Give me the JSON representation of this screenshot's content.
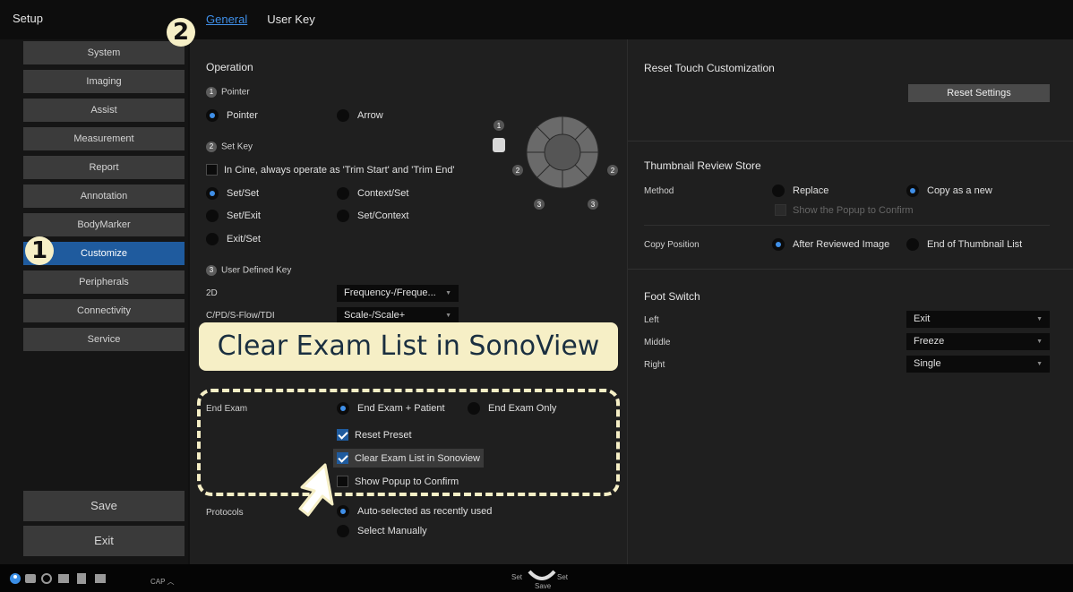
{
  "app": {
    "title": "Setup"
  },
  "tabs": [
    {
      "label": "General",
      "active": true
    },
    {
      "label": "User Key",
      "active": false
    }
  ],
  "sidebar": {
    "items": [
      "System",
      "Imaging",
      "Assist",
      "Measurement",
      "Report",
      "Annotation",
      "BodyMarker",
      "Customize",
      "Peripherals",
      "Connectivity",
      "Service"
    ],
    "active": "Customize",
    "save_label": "Save",
    "exit_label": "Exit"
  },
  "operation": {
    "title": "Operation",
    "pointer": {
      "num": "1",
      "label": "Pointer",
      "options": [
        {
          "label": "Pointer",
          "selected": true
        },
        {
          "label": "Arrow",
          "selected": false
        }
      ]
    },
    "setkey": {
      "num": "2",
      "label": "Set Key",
      "cine_check": {
        "label": "In Cine, always operate as 'Trim Start' and 'Trim End'",
        "checked": false
      },
      "options": [
        {
          "label": "Set/Set",
          "selected": true
        },
        {
          "label": "Context/Set",
          "selected": false
        },
        {
          "label": "Set/Exit",
          "selected": false
        },
        {
          "label": "Set/Context",
          "selected": false
        },
        {
          "label": "Exit/Set",
          "selected": false
        }
      ]
    },
    "userkey": {
      "num": "3",
      "label": "User Defined Key",
      "rows": [
        {
          "label": "2D",
          "value": "Frequency-/Freque..."
        },
        {
          "label": "C/PD/S-Flow/TDI",
          "value": "Scale-/Scale+"
        }
      ]
    },
    "diagram_labels": {
      "one": "1",
      "two": "2",
      "three": "3"
    }
  },
  "end_exam": {
    "label": "End Exam",
    "options": [
      {
        "label": "End Exam + Patient",
        "selected": true
      },
      {
        "label": "End Exam Only",
        "selected": false
      }
    ],
    "checks": [
      {
        "label": "Reset Preset",
        "checked": true
      },
      {
        "label": "Clear Exam List in Sonoview",
        "checked": true
      },
      {
        "label": "Show Popup to Confirm",
        "checked": false
      }
    ]
  },
  "protocols": {
    "label": "Protocols",
    "options": [
      {
        "label": "Auto-selected as recently used",
        "selected": true
      },
      {
        "label": "Select Manually",
        "selected": false
      }
    ]
  },
  "reset_touch": {
    "title": "Reset Touch Customization",
    "button": "Reset Settings"
  },
  "thumbnail": {
    "title": "Thumbnail Review Store",
    "method_label": "Method",
    "method_options": [
      {
        "label": "Replace",
        "selected": false
      },
      {
        "label": "Copy as a new",
        "selected": true
      }
    ],
    "popup_check": "Show the Popup to Confirm",
    "copypos_label": "Copy Position",
    "copypos_options": [
      {
        "label": "After Reviewed Image",
        "selected": true
      },
      {
        "label": "End of Thumbnail List",
        "selected": false
      }
    ]
  },
  "foot_switch": {
    "title": "Foot Switch",
    "rows": [
      {
        "label": "Left",
        "value": "Exit"
      },
      {
        "label": "Middle",
        "value": "Freeze"
      },
      {
        "label": "Right",
        "value": "Single"
      }
    ]
  },
  "callout": {
    "text": "Clear Exam List in SonoView",
    "marker1": "1",
    "marker2": "2"
  },
  "statusbar": {
    "cap": "CAP",
    "set_left": "Set",
    "set_right": "Set",
    "save": "Save"
  },
  "colors": {
    "accent": "#3f8fe8",
    "active_item": "#1f5b9e",
    "callout": "#f6efc6"
  }
}
